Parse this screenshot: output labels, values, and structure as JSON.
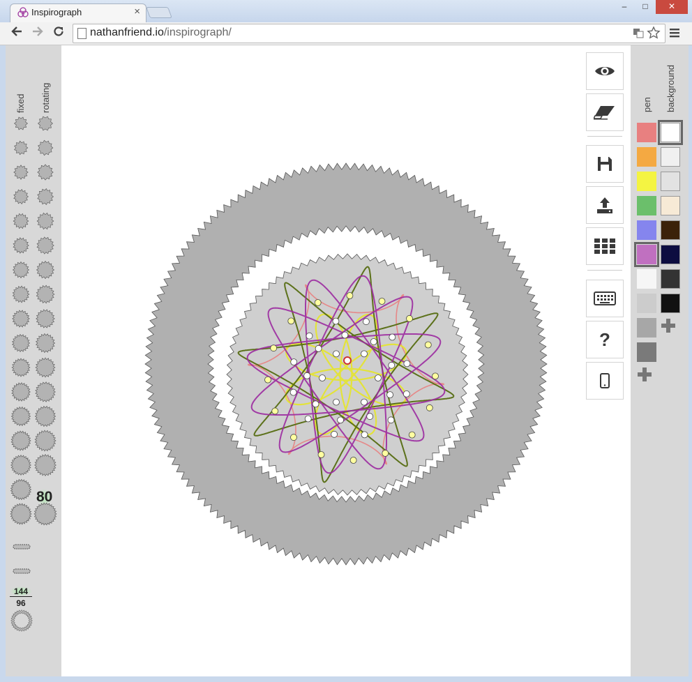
{
  "browser": {
    "tab_title": "Inspirograph",
    "tab_close": "×",
    "url_domain": "nathanfriend.io",
    "url_path": "/inspirograph/",
    "win_min": "–",
    "win_max": "□",
    "win_close": "✕"
  },
  "left_panel": {
    "fixed_label": "fixed",
    "rotating_label": "rotating",
    "selected_rotating_value": "80",
    "ratio_top": "144",
    "ratio_bottom": "96"
  },
  "right_panel": {
    "pen_label": "pen",
    "background_label": "background",
    "pen_colors": [
      "#e88080",
      "#f4a942",
      "#f4f442",
      "#6bbf6b",
      "#8585ee",
      "#c070c0",
      "#f6f6f6",
      "#cccccc",
      "#a7a7a7",
      "#7a7a7a"
    ],
    "pen_selected": 5,
    "bg_colors": [
      "#ffffff",
      "#f0f0f0",
      "#e2e2e2",
      "#f7ead6",
      "#3b2209",
      "#0d0d40",
      "#333333",
      "#111111"
    ],
    "bg_selected": 0
  },
  "tools": [
    "eye-icon",
    "eraser-icon",
    "save-icon",
    "upload-icon",
    "grid-icon",
    "keyboard-icon",
    "help-icon",
    "mobile-icon"
  ],
  "tool_help": "?"
}
